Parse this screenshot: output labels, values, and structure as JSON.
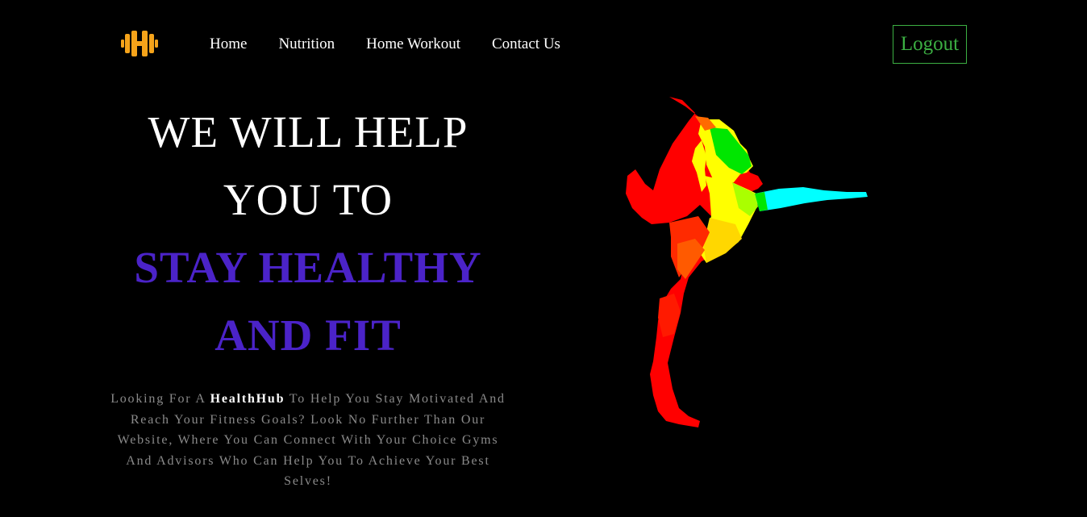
{
  "header": {
    "logo_icon": "dumbbell-h-icon",
    "logo_color": "#f5a31a",
    "nav": [
      {
        "label": "Home"
      },
      {
        "label": "Nutrition"
      },
      {
        "label": "Home Workout"
      },
      {
        "label": "Contact Us"
      }
    ],
    "logout_label": "Logout",
    "logout_color": "#3cb043"
  },
  "hero": {
    "line1": "WE WILL HELP",
    "line2": "YOU TO",
    "line3": "STAY HEALTHY",
    "line4": "AND FIT",
    "accent_color": "#4b23c8",
    "desc_before": "Looking For A ",
    "desc_brand": "HealthHub",
    "desc_after": " To Help You Stay Motivated And Reach Your Fitness Goals? Look No Further Than Our Website, Where You Can Connect With Your Choice Gyms And Advisors Who Can Help You To Achieve Your Best Selves!"
  },
  "illustration": {
    "icon": "yoga-dancer-pose-figure",
    "colors": [
      "#ff0000",
      "#ff4500",
      "#ffa500",
      "#ffff00",
      "#aaff00",
      "#00ff00",
      "#00ffff"
    ]
  }
}
